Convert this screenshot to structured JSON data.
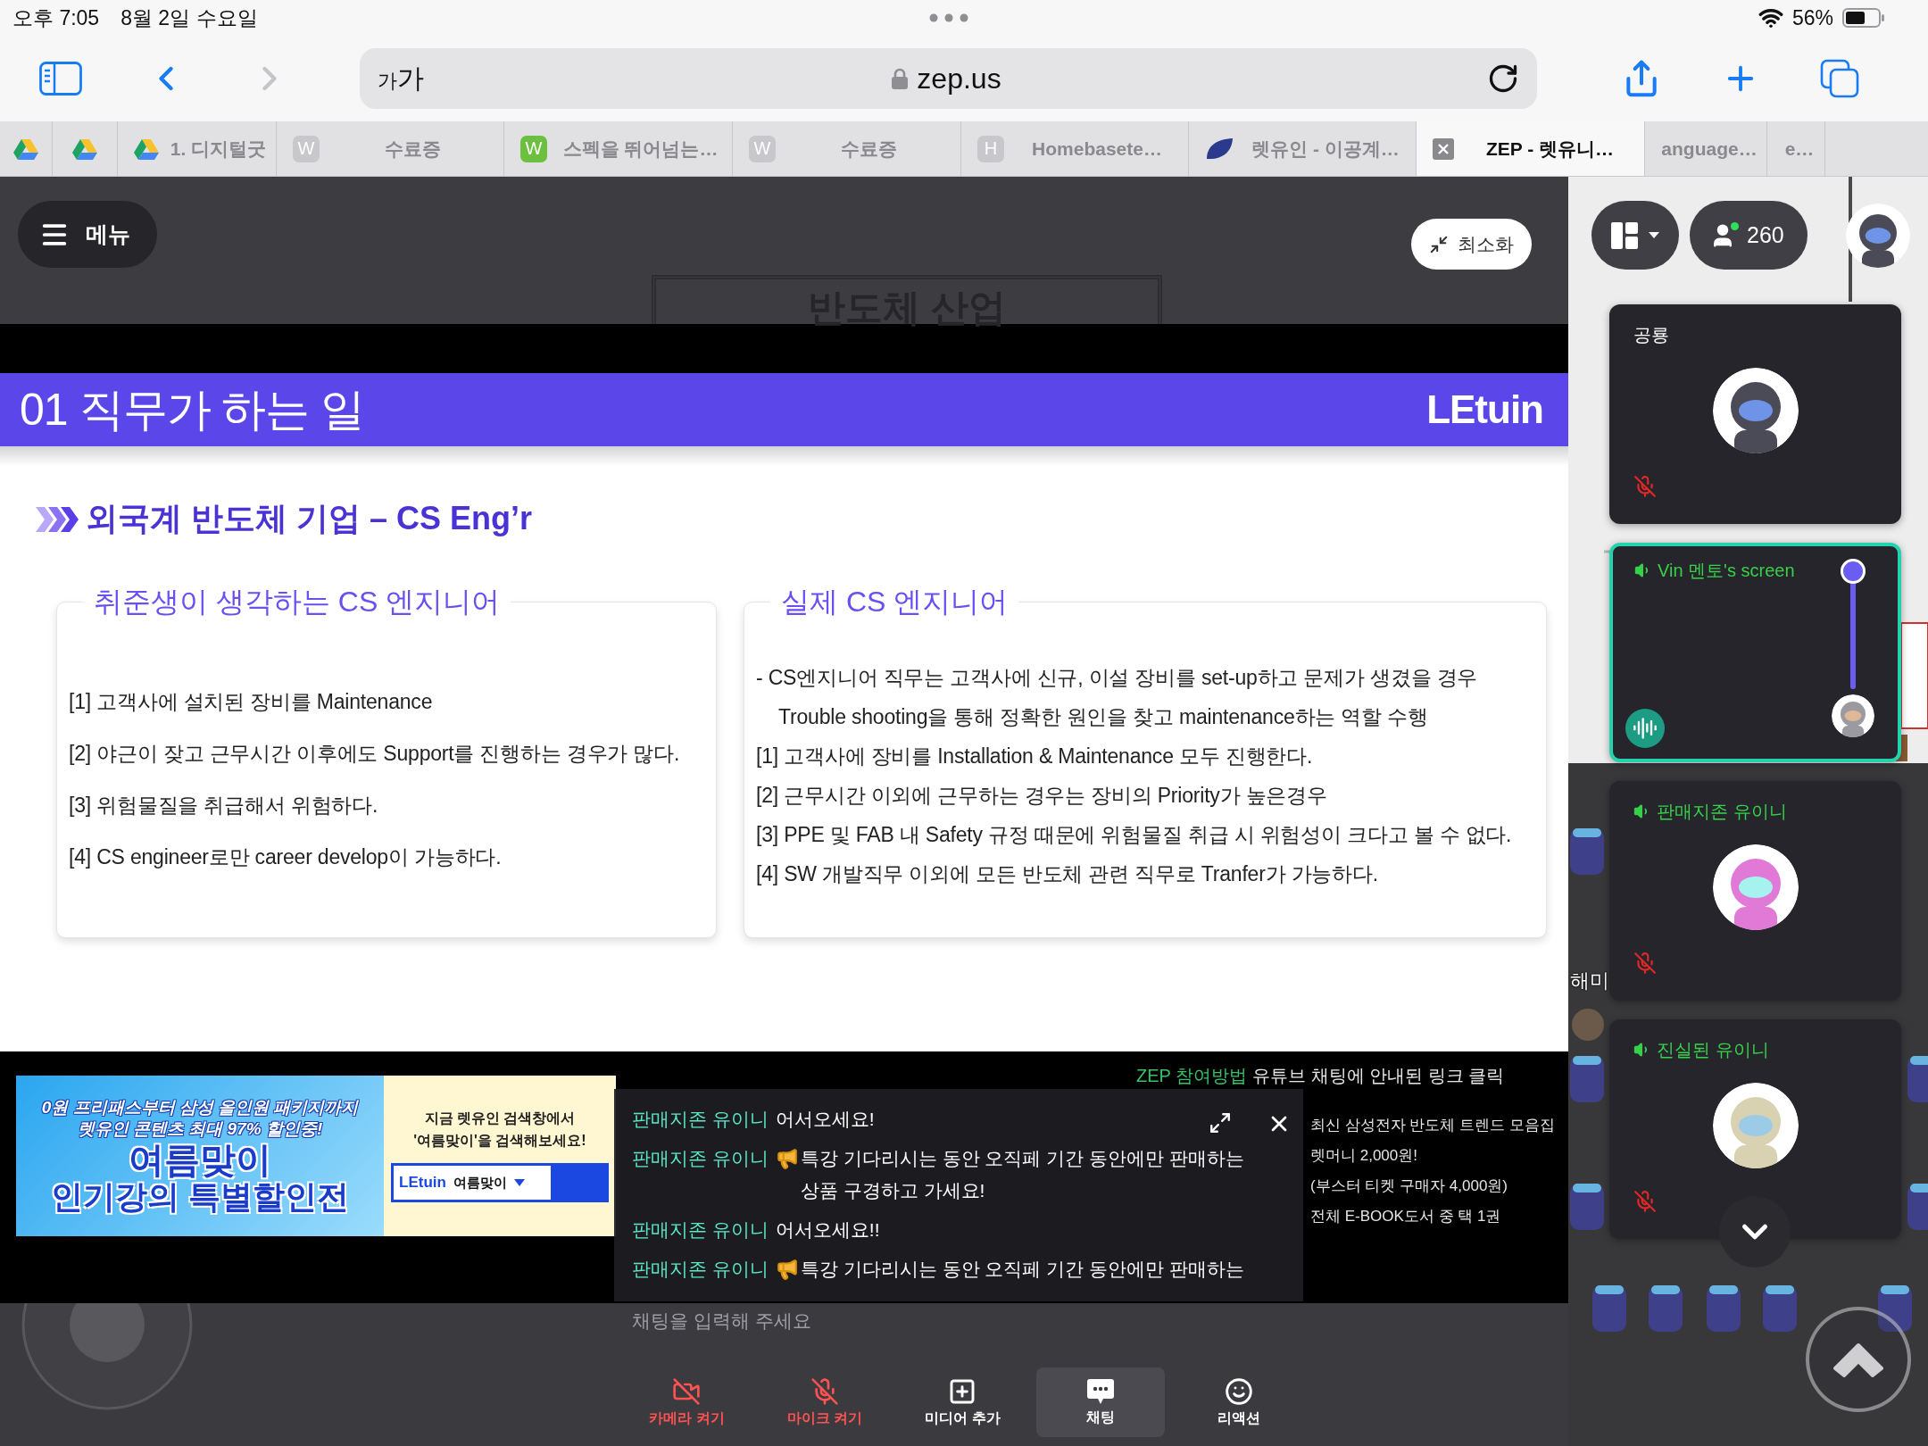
{
  "status_bar": {
    "time": "오후 7:05",
    "date": "8월 2일 수요일",
    "battery": "56%"
  },
  "browser": {
    "text_size": "가가",
    "url": "zep.us",
    "back_disabled": false,
    "forward_disabled": true,
    "tabs": [
      {
        "kind": "triangle",
        "selected": false
      },
      {
        "kind": "triangle",
        "selected": false
      },
      {
        "kind": "triangle",
        "title": "1. 디지털굿",
        "selected": false
      },
      {
        "kind": "tile",
        "letter": "W",
        "title": "수료증",
        "selected": false
      },
      {
        "kind": "green-tile",
        "letter": "W",
        "title": "스펙을 뛰어넘는…",
        "selected": false
      },
      {
        "kind": "tile",
        "letter": "W",
        "title": "수료증",
        "selected": false
      },
      {
        "kind": "tile",
        "letter": "H",
        "title": "Homebasete…",
        "selected": false
      },
      {
        "kind": "leaf",
        "title": "렛유인 - 이공계…",
        "selected": false
      },
      {
        "kind": "close",
        "title": "ZEP - 렛유니…",
        "selected": true
      },
      {
        "kind": "none",
        "title": "anguage…",
        "selected": false
      },
      {
        "kind": "none",
        "title": "e…",
        "selected": false
      }
    ]
  },
  "game": {
    "menu_label": "메뉴",
    "minimize_label": "최소화",
    "map_sign": "반도체 산업",
    "player_label": "해미",
    "participant_count": "260"
  },
  "slide": {
    "header": "01 직무가 하는 일",
    "logo": "LEtuin",
    "subtitle": "외국계 반도체 기업 – CS Eng’r",
    "panels": [
      {
        "title": "취준생이 생각하는 CS 엔지니어",
        "items": [
          "[1] 고객사에 설치된 장비를 Maintenance",
          "[2] 야근이 잦고 근무시간 이후에도 Support를 진행하는 경우가 많다.",
          "[3] 위험물질을 취급해서 위험하다.",
          "[4] CS engineer로만 career develop이 가능하다."
        ]
      },
      {
        "title": "실제 CS 엔지니어",
        "items": [
          "- CS엔지니어 직무는 고객사에 신규, 이설 장비를 set-up하고 문제가 생겼을 경우\nTrouble shooting을 통해 정확한 원인을 찾고 maintenance하는 역할 수행",
          "[1] 고객사에 장비를 Installation & Maintenance 모두 진행한다.",
          "[2] 근무시간 이외에 근무하는 경우는 장비의 Priority가 높은경우",
          "[3] PPE 및 FAB 내 Safety 규정 때문에 위험물질 취급 시 위험성이 크다고 볼 수 없다.",
          "[4] SW 개발직무 이외에 모든 반도체 관련 직무로 Tranfer가 가능하다."
        ]
      }
    ]
  },
  "video_banner": {
    "lines": [
      "0원 프리패스부터 삼성 올인원 패키지까지",
      "렛유인 콘텐츠 최대 97% 할인중!"
    ],
    "title": [
      "여름맞이",
      "인기강의 특별할인전"
    ],
    "prompt": [
      "지금 렛유인 검색창에서",
      "'여름맞이'을 검색해보세요!"
    ],
    "search_logo": "LEtuin",
    "search_term": "여름맞이"
  },
  "video_notes": [
    {
      "label": "ZEP 참여방법",
      "text": "유튜브 채팅에 안내된 링크 클릭"
    },
    {
      "text": "최신 삼성전자 반도체 트렌드 모음집"
    },
    {
      "text": "렛머니 2,000원!"
    },
    {
      "text": "(부스터 티켓 구매자 4,000원)"
    },
    {
      "text": "전체 E-BOOK도서 중 택 1권"
    }
  ],
  "chat": {
    "messages": [
      {
        "kind": "text",
        "sender": "판매지존 유이니",
        "text": "어서오세요!"
      },
      {
        "kind": "notice",
        "sender": "판매지존 유이니",
        "text": "특강 기다리시는 동안 오직페 기간 동안에만 판매하는 상품 구경하고 가세요!"
      },
      {
        "kind": "text",
        "sender": "판매지존 유이니",
        "text": "어서오세요!!"
      },
      {
        "kind": "notice",
        "sender": "판매지존 유이니",
        "text": "특강 기다리시는 동안 오직페 기간 동안에만 판매하는"
      }
    ],
    "placeholder": "채팅을 입력해 주세요"
  },
  "toolbar": [
    {
      "kind": "camera",
      "label": "카메라 켜기",
      "off": true,
      "selected": false
    },
    {
      "kind": "mic",
      "label": "마이크 켜기",
      "off": true,
      "selected": false
    },
    {
      "kind": "media",
      "label": "미디어 추가",
      "off": false,
      "selected": false
    },
    {
      "kind": "chat",
      "label": "채팅",
      "off": false,
      "selected": true
    },
    {
      "kind": "reaction",
      "label": "리액션",
      "off": false,
      "selected": false
    }
  ],
  "participants": [
    {
      "kind": "camera",
      "name": "공룡",
      "audio": false,
      "mic_muted": true,
      "pinned": false
    },
    {
      "kind": "screen",
      "name": "Vin 멘토's screen",
      "audio": true,
      "level": 1,
      "pinned": true
    },
    {
      "kind": "camera",
      "name": "판매지존 유이니",
      "audio": true,
      "mic_muted": true,
      "pinned": false
    },
    {
      "kind": "camera",
      "name": "진실된 유이니",
      "audio": true,
      "mic_muted": true,
      "pinned": false
    }
  ]
}
